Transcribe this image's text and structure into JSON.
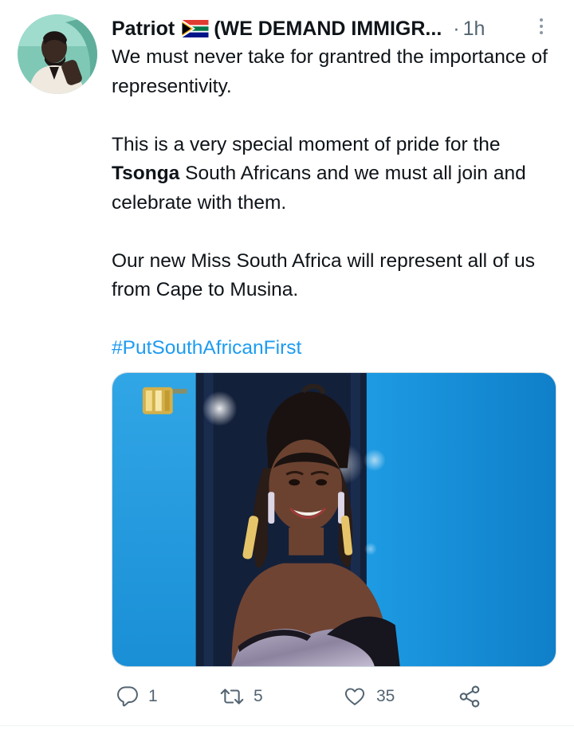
{
  "tweet": {
    "author_name": "Patriot",
    "author_suffix": "(WE DEMAND IMMIGR...",
    "dot": "·",
    "time": "1h",
    "paragraphs": {
      "p1": "We must never take for grantred the importance of representivity.",
      "p2_before": "This is a very special moment of pride for the ",
      "p2_bold": "Tsonga",
      "p2_after": " South Africans and we must all join and celebrate with them.",
      "p3": "Our new Miss South Africa will represent all of us from Cape to Musina."
    },
    "hashtag": "#PutSouthAfricanFirst"
  },
  "actions": {
    "reply_count": "1",
    "retweet_count": "5",
    "like_count": "35"
  },
  "icons": {
    "flag": "south-africa-flag-icon",
    "more": "more-vertical-icon",
    "reply": "reply-icon",
    "retweet": "retweet-icon",
    "like": "heart-icon",
    "share": "share-icon"
  },
  "colors": {
    "accent": "#1d9bf0",
    "muted": "#536471",
    "text": "#0f1419"
  }
}
